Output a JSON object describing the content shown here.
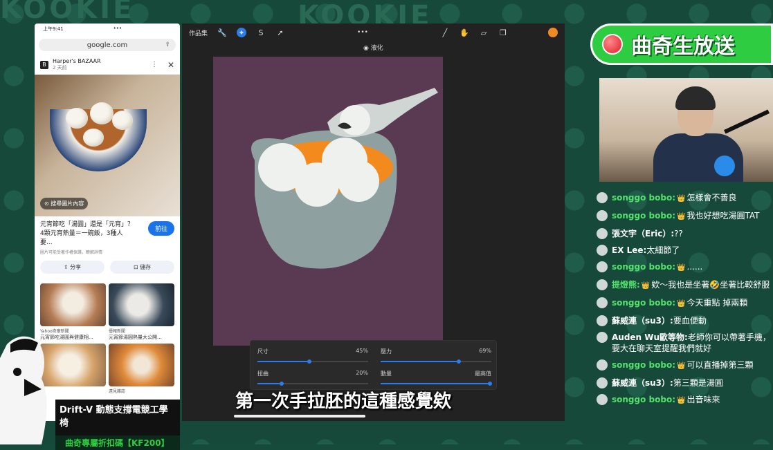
{
  "background": {
    "watermark_text": "KOOKIE"
  },
  "phone": {
    "status_time": "上午9:41",
    "status_dots": "•••",
    "url": "google.com",
    "source_name": "Harper's BAZAAR",
    "source_date": "2 天前",
    "lens_button": "搜尋圖片內容",
    "result_title": "元宵節吃「湯圓」還是「元宵」？4顆元宵熱量＝一碗飯，3種人要...",
    "go_button": "前往",
    "meta": "圖片可能受著作權保護。瞭解詳情",
    "share_button": "分享",
    "save_button": "儲存",
    "grid": [
      {
        "source": "Yahoo奇摩新聞",
        "title": "元宵節吃湯圓與健康相..."
      },
      {
        "source": "優報新聞",
        "title": "元宵節湯圓熱量大公開..."
      },
      {
        "source": "",
        "title": ""
      },
      {
        "source": "遠見雜誌",
        "title": ""
      }
    ]
  },
  "procreate": {
    "gallery_label": "作品集",
    "more_dots": "•••",
    "tool_label": "液化",
    "sliders": [
      {
        "label": "尺寸",
        "value": "45%",
        "level": 0.45
      },
      {
        "label": "壓力",
        "value": "69%",
        "level": 0.69
      },
      {
        "label": "扭曲",
        "value": "20%",
        "level": 0.2
      },
      {
        "label": "動量",
        "value": "最高值",
        "level": 1.0
      }
    ]
  },
  "badge": {
    "text": "曲奇生放送"
  },
  "chat": [
    {
      "user": "songgo bobo:",
      "text": "怎樣會不善良",
      "green": true,
      "crown": true
    },
    {
      "user": "songgo bobo:",
      "text": "我也好想吃湯圓TAT",
      "green": true,
      "crown": true
    },
    {
      "user": "張文宇（Eric）:",
      "text": "??",
      "green": false,
      "crown": false
    },
    {
      "user": "EX Lee:",
      "text": "太細節了",
      "green": false,
      "crown": false
    },
    {
      "user": "songgo bobo:",
      "text": "......",
      "green": true,
      "crown": true
    },
    {
      "user": "提燈熊:",
      "text": "欸～我也是坐著🤣坐著比較舒服",
      "green": true,
      "crown": true
    },
    {
      "user": "songgo bobo:",
      "text": "今天重點 掉兩顆",
      "green": true,
      "crown": true
    },
    {
      "user": "蘇威連（su3）:",
      "text": "要血便動",
      "green": false,
      "crown": false
    },
    {
      "user": "Auden Wu歐等物:",
      "text": "老師你可以帶著手機，要大在聊天室提醒我們就好",
      "green": false,
      "crown": false
    },
    {
      "user": "songgo bobo:",
      "text": "可以直播掉第三顆",
      "green": true,
      "crown": true
    },
    {
      "user": "蘇威連（su3）:",
      "text": "第三顆是湯圓",
      "green": false,
      "crown": false
    },
    {
      "user": "songgo bobo:",
      "text": "出音味來",
      "green": true,
      "crown": true
    }
  ],
  "caption": "第一次手拉胚的這種感覺欸",
  "ad": {
    "line1": "Drift-V 動態支撐電競工學椅",
    "line2": "曲奇專屬折扣碼【KF200】"
  },
  "colors": {
    "accent_green": "#2ecc40",
    "active_tool": "#2b7de9",
    "canvas_bg": "#5a3a52",
    "current_color": "#f08a24"
  }
}
